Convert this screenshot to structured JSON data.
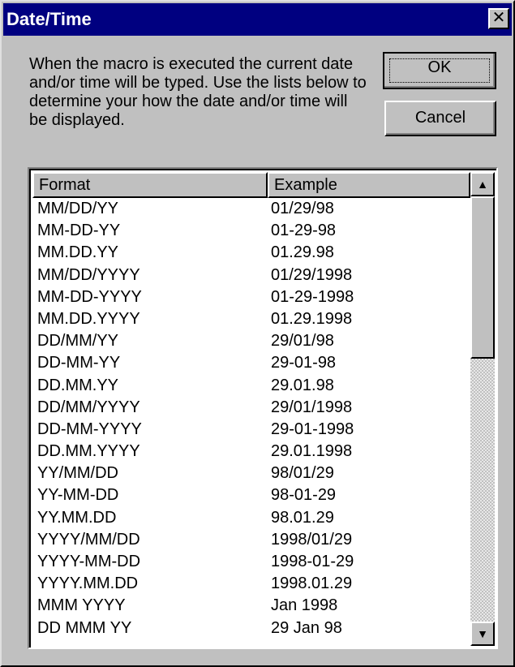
{
  "window": {
    "title": "Date/Time",
    "close_glyph": "✕"
  },
  "description": "When the macro is executed the current date and/or time will be typed.  Use the lists below to determine your how the date and/or time will be displayed.",
  "buttons": {
    "ok_label": "OK",
    "cancel_label": "Cancel"
  },
  "list": {
    "columns": [
      "Format",
      "Example"
    ],
    "rows": [
      [
        "MM/DD/YY",
        "01/29/98"
      ],
      [
        "MM-DD-YY",
        "01-29-98"
      ],
      [
        "MM.DD.YY",
        "01.29.98"
      ],
      [
        "MM/DD/YYYY",
        "01/29/1998"
      ],
      [
        "MM-DD-YYYY",
        "01-29-1998"
      ],
      [
        "MM.DD.YYYY",
        "01.29.1998"
      ],
      [
        "DD/MM/YY",
        "29/01/98"
      ],
      [
        "DD-MM-YY",
        "29-01-98"
      ],
      [
        "DD.MM.YY",
        "29.01.98"
      ],
      [
        "DD/MM/YYYY",
        "29/01/1998"
      ],
      [
        "DD-MM-YYYY",
        "29-01-1998"
      ],
      [
        "DD.MM.YYYY",
        "29.01.1998"
      ],
      [
        "YY/MM/DD",
        "98/01/29"
      ],
      [
        "YY-MM-DD",
        "98-01-29"
      ],
      [
        "YY.MM.DD",
        "98.01.29"
      ],
      [
        "YYYY/MM/DD",
        "1998/01/29"
      ],
      [
        "YYYY-MM-DD",
        "1998-01-29"
      ],
      [
        "YYYY.MM.DD",
        "1998.01.29"
      ],
      [
        "MMM YYYY",
        "Jan 1998"
      ],
      [
        "DD MMM YY",
        "29 Jan 98"
      ]
    ]
  },
  "scrollbar": {
    "up_glyph": "▲",
    "down_glyph": "▼",
    "position_fraction": 0.0
  },
  "colors": {
    "titlebar": "#000080",
    "face": "#c0c0c0"
  }
}
